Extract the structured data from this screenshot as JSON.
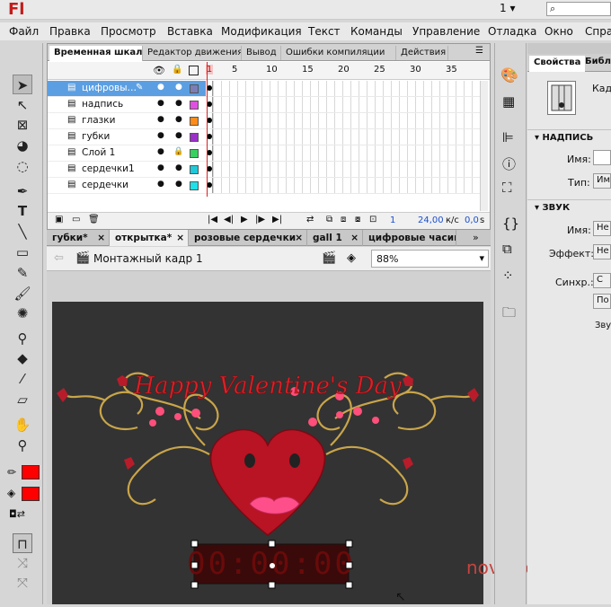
{
  "app": {
    "logo": "Fl",
    "workspace": "1"
  },
  "menu": [
    "Файл",
    "Правка",
    "Просмотр",
    "Вставка",
    "Модификация",
    "Текст",
    "Команды",
    "Управление",
    "Отладка",
    "Окно",
    "Спра"
  ],
  "panel_tabs": [
    "Временная шкала",
    "Редактор движения",
    "Вывод",
    "Ошибки компиляции",
    "Действия"
  ],
  "timeline": {
    "ruler": [
      "1",
      "5",
      "10",
      "15",
      "20",
      "25",
      "30",
      "35"
    ],
    "layers": [
      {
        "name": "цифровы…",
        "color": "#7d7db5",
        "selected": true,
        "locked": false
      },
      {
        "name": "надпись",
        "color": "#e050e0",
        "selected": false,
        "locked": false
      },
      {
        "name": "глазки",
        "color": "#ff8c1a",
        "selected": false,
        "locked": false
      },
      {
        "name": "губки",
        "color": "#9b30c8",
        "selected": false,
        "locked": false
      },
      {
        "name": "Слой 1",
        "color": "#39d060",
        "selected": false,
        "locked": true
      },
      {
        "name": "сердечки1",
        "color": "#20c8d8",
        "selected": false,
        "locked": false
      },
      {
        "name": "сердечки",
        "color": "#20e0e8",
        "selected": false,
        "locked": false
      }
    ],
    "frame": "1",
    "fps": "24,00",
    "fps_unit": "к/с",
    "time": "0,0",
    "time_unit": "s"
  },
  "doc_tabs": [
    "губки*",
    "открытка*",
    "розовые сердечки",
    "gall 1",
    "цифровые часики"
  ],
  "edit": {
    "scene": "Монтажный кадр 1",
    "zoom": "88%"
  },
  "card": {
    "title": "Happy Valentine's Day",
    "clock": "00:00:00",
    "watermark": "novprospekt"
  },
  "props": {
    "tabs": [
      "Свойства",
      "Библ"
    ],
    "frame_label": "Кад",
    "sections": [
      "НАДПИСЬ",
      "ЗВУК"
    ],
    "name_label": "Имя:",
    "type_label": "Тип:",
    "type_value": "Им",
    "sound_name_label": "Имя:",
    "sound_name_value": "Не",
    "effect_label": "Эффект:",
    "effect_value": "Не",
    "sync_label": "Синхр.:",
    "sync_value": "С",
    "sync_value2": "По",
    "sound_footer": "Зву"
  },
  "colors": {
    "stroke": "#ff0000",
    "fill": "#ff0000"
  }
}
